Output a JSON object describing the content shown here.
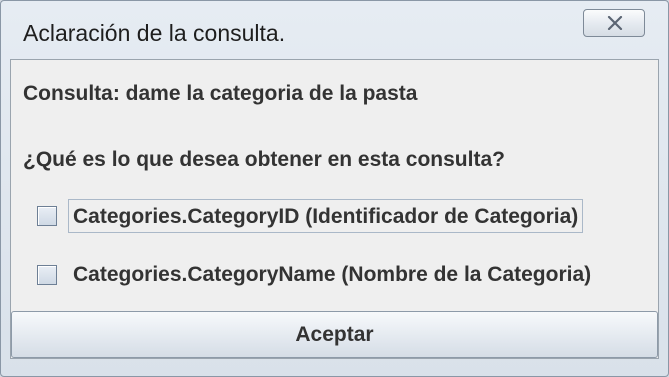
{
  "window": {
    "title": "Aclaración de la consulta."
  },
  "icons": {
    "close": "close-icon"
  },
  "content": {
    "query_text": "Consulta: dame la categoria de la pasta",
    "question_text": "¿Qué es lo que desea obtener en esta consulta?",
    "options": [
      {
        "label": "Categories.CategoryID (Identificador de Categoria)",
        "checked": false,
        "focused": true
      },
      {
        "label": "Categories.CategoryName (Nombre de la Categoria)",
        "checked": false,
        "focused": false
      }
    ],
    "accept_label": "Aceptar"
  },
  "colors": {
    "window_bg": "#dde4ec",
    "content_bg": "#efefef",
    "text": "#333333"
  }
}
